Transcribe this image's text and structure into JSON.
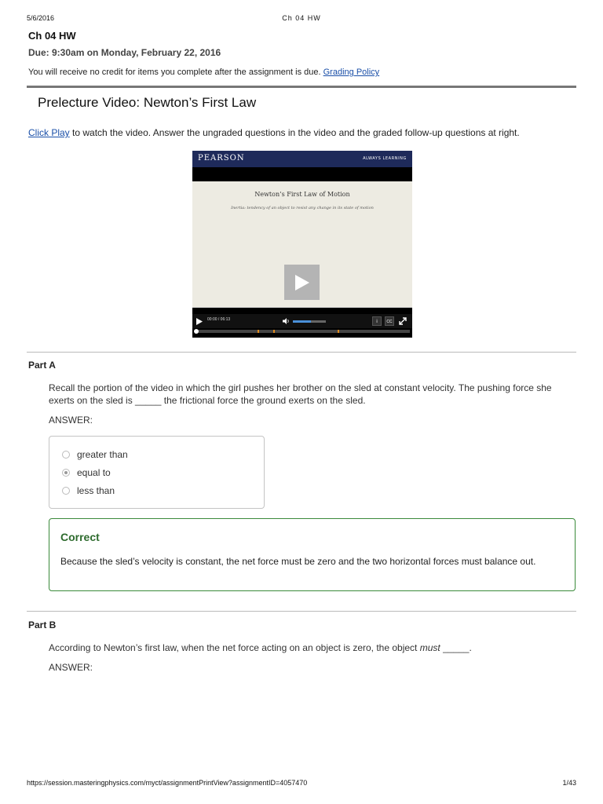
{
  "print_header": {
    "date": "5/6/2016",
    "title": "Ch 04 HW"
  },
  "assignment": {
    "title": "Ch 04 HW",
    "due": "Due: 9:30am on Monday, February 22, 2016",
    "credit_notice": "You will receive no credit for items you complete after the assignment is due.",
    "grading_policy_link": "Grading Policy"
  },
  "section": {
    "title": "Prelecture Video: Newton’s First Law",
    "instructions_link": "Click Play",
    "instructions_rest": " to watch the video. Answer the ungraded questions in the video and the graded follow-up questions at right."
  },
  "video": {
    "brand": "PEARSON",
    "tagline": "ALWAYS LEARNING",
    "slide_title": "Newton’s First Law of Motion",
    "slide_subtitle": "Inertia: tendency of an object to resist any change in its state of motion",
    "time": "00:00  /  06:13",
    "volume_level": 0.55,
    "progress": 0.0,
    "info_label": "i",
    "cc_label": "CC",
    "colors": {
      "brand_bar": "#1e2a5a",
      "volume": "#4a90d9",
      "marker": "#e08a1c"
    }
  },
  "part_a": {
    "label": "Part A",
    "question": "Recall the portion of the video in which the girl pushes her brother on the sled at constant velocity. The pushing force she exerts on the sled is _____ the frictional force the ground exerts on the sled.",
    "answer_label": "ANSWER:",
    "choices": [
      "greater than",
      "equal to",
      "less than"
    ],
    "selected_index": 1,
    "feedback_title": "Correct",
    "feedback_text": "Because the sled’s velocity is constant, the net force must be zero and the two horizontal forces must balance out."
  },
  "part_b": {
    "label": "Part B",
    "question_before": "According to Newton’s first law, when the net force acting on an object is zero, the object ",
    "question_emphasis": "must",
    "question_after": " _____.",
    "answer_label": "ANSWER:"
  },
  "footer": {
    "url": "https://session.masteringphysics.com/myct/assignmentPrintView?assignmentID=4057470",
    "page": "1/43"
  }
}
